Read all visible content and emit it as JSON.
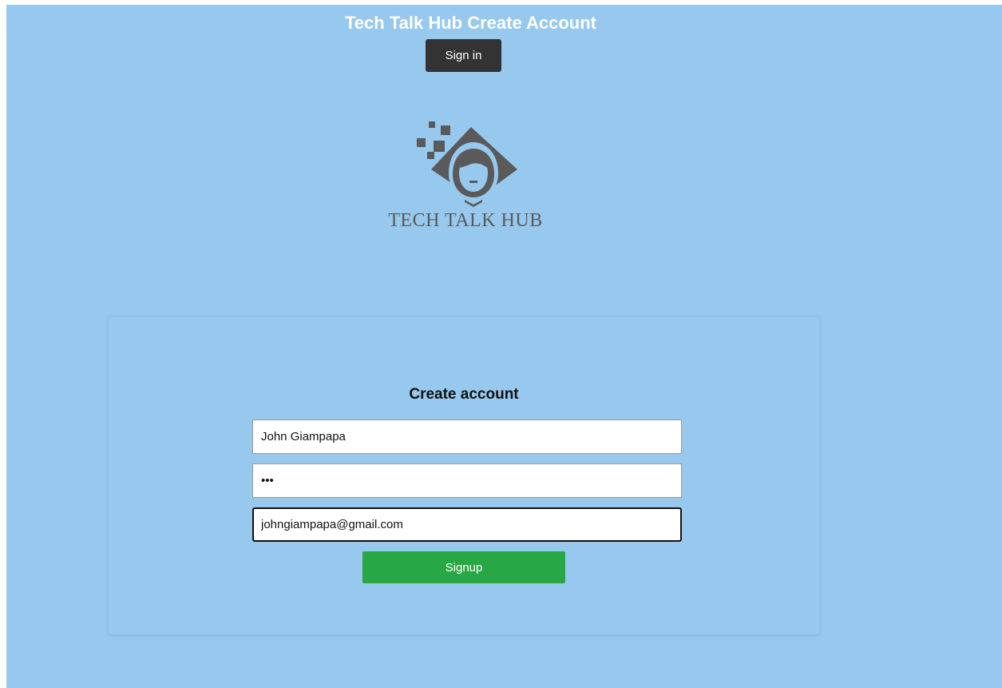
{
  "header": {
    "title": "Tech Talk Hub Create Account",
    "signin_label": "Sign in"
  },
  "logo": {
    "text": "TECH TALK HUB",
    "icon": "hacker-avatar-icon"
  },
  "form": {
    "title": "Create account",
    "name_value": "John Giampapa",
    "password_value": "abc",
    "email_value": "johngiampapa@gmail.com",
    "submit_label": "Signup"
  },
  "colors": {
    "background": "#97c8ee",
    "signin_button": "#333333",
    "signup_button": "#28a745",
    "logo": "#5a5a5a"
  }
}
